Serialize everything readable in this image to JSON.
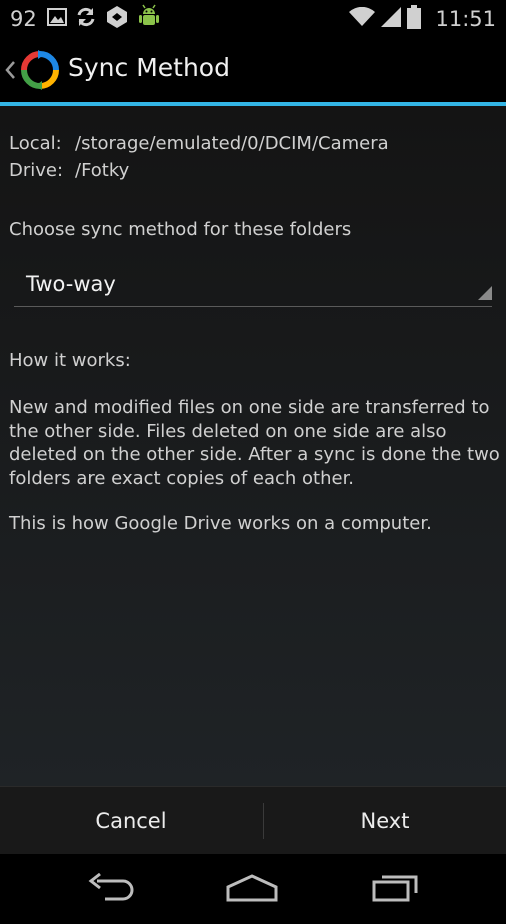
{
  "status_bar": {
    "notification_count": "92",
    "time": "11:51",
    "icons": [
      "image-icon",
      "sync-icon",
      "hexagon-app-icon",
      "android-debug-icon",
      "wifi-icon",
      "signal-icon",
      "battery-icon"
    ]
  },
  "action_bar": {
    "title": "Sync Method",
    "logo_colors": [
      "#e53935",
      "#ffb300",
      "#43a047",
      "#1e88e5"
    ]
  },
  "folders": {
    "local_label": "Local:",
    "local_path": "/storage/emulated/0/DCIM/Camera",
    "drive_label": "Drive:",
    "drive_path": "/Fotky"
  },
  "choose_label": "Choose sync method for these folders",
  "sync_method": {
    "selected": "Two-way"
  },
  "how_label": "How it works:",
  "description": "New and modified files on one side are transferred to the other side. Files deleted on one side are also deleted on the other side. After a sync is done the two folders are exact copies of each other.",
  "note": "This is how Google Drive works on a computer.",
  "buttons": {
    "cancel": "Cancel",
    "next": "Next"
  },
  "colors": {
    "accent": "#33b5e5"
  }
}
